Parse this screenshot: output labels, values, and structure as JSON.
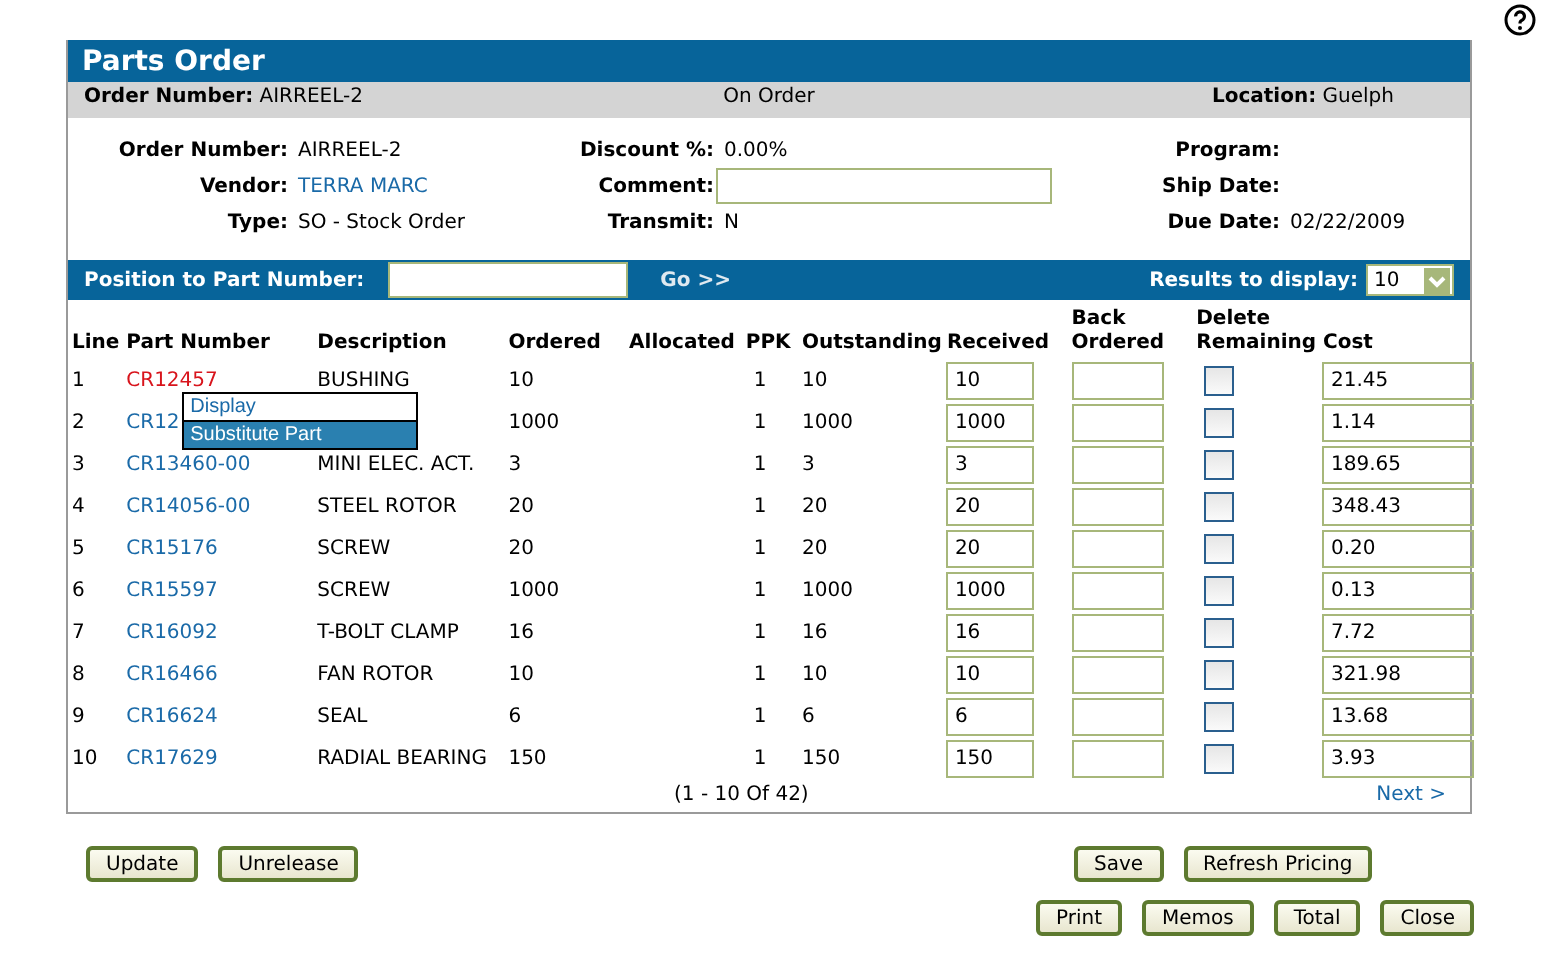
{
  "panel": {
    "title": "Parts Order"
  },
  "summary": {
    "order_label": "Order Number:",
    "order_value": "AIRREEL-2",
    "status": "On Order",
    "location_label": "Location:",
    "location_value": "Guelph"
  },
  "details": [
    {
      "label": "Order Number:",
      "value": "AIRREEL-2",
      "kind": "text"
    },
    {
      "label": "Discount %:",
      "value": "0.00%",
      "kind": "text"
    },
    {
      "label": "Program:",
      "kind": "text"
    },
    {
      "label": "Vendor:",
      "value": "TERRA MARC",
      "kind": "link"
    },
    {
      "label": "Comment:",
      "kind": "field"
    },
    {
      "label": "Ship Date:",
      "kind": "text"
    },
    {
      "label": "Type:",
      "value": "SO - Stock Order",
      "kind": "text"
    },
    {
      "label": "Transmit:",
      "value": "N",
      "kind": "text"
    },
    {
      "label": "Due Date:",
      "value": "02/22/2009",
      "kind": "text"
    }
  ],
  "search_bar": {
    "label": "Position to Part Number:",
    "go": "Go >>",
    "results_label": "Results to display:",
    "results_value": "10"
  },
  "table": {
    "columns": [
      "Line",
      "Part Number",
      "Description",
      "Ordered",
      "Allocated",
      "PPK",
      "Outstanding",
      "Received",
      "Back Ordered",
      "Delete Remaining",
      "Cost"
    ],
    "rows": [
      {
        "line": "1",
        "part": "CR12457",
        "description": "BUSHING",
        "ordered": "10",
        "ppk": "1",
        "outstanding": "10",
        "received": "10",
        "delete": false,
        "cost": "21.45",
        "selected": true
      },
      {
        "line": "2",
        "part": "CR12",
        "ordered": "1000",
        "ppk": "1",
        "outstanding": "1000",
        "received": "1000",
        "delete": false,
        "cost": "1.14",
        "selected": false
      },
      {
        "line": "3",
        "part": "CR13460-00",
        "description": "MINI ELEC. ACT.",
        "ordered": "3",
        "ppk": "1",
        "outstanding": "3",
        "received": "3",
        "delete": false,
        "cost": "189.65",
        "selected": false
      },
      {
        "line": "4",
        "part": "CR14056-00",
        "description": "STEEL ROTOR",
        "ordered": "20",
        "ppk": "1",
        "outstanding": "20",
        "received": "20",
        "delete": false,
        "cost": "348.43",
        "selected": false
      },
      {
        "line": "5",
        "part": "CR15176",
        "description": "SCREW",
        "ordered": "20",
        "ppk": "1",
        "outstanding": "20",
        "received": "20",
        "delete": false,
        "cost": "0.20",
        "selected": false
      },
      {
        "line": "6",
        "part": "CR15597",
        "description": "SCREW",
        "ordered": "1000",
        "ppk": "1",
        "outstanding": "1000",
        "received": "1000",
        "delete": false,
        "cost": "0.13",
        "selected": false
      },
      {
        "line": "7",
        "part": "CR16092",
        "description": "T-BOLT CLAMP",
        "ordered": "16",
        "ppk": "1",
        "outstanding": "16",
        "received": "16",
        "delete": false,
        "cost": "7.72",
        "selected": false
      },
      {
        "line": "8",
        "part": "CR16466",
        "description": "FAN ROTOR",
        "ordered": "10",
        "ppk": "1",
        "outstanding": "10",
        "received": "10",
        "delete": false,
        "cost": "321.98",
        "selected": false
      },
      {
        "line": "9",
        "part": "CR16624",
        "description": "SEAL",
        "ordered": "6",
        "ppk": "1",
        "outstanding": "6",
        "received": "6",
        "delete": false,
        "cost": "13.68",
        "selected": false
      },
      {
        "line": "10",
        "part": "CR17629",
        "description": "RADIAL BEARING",
        "ordered": "150",
        "ppk": "1",
        "outstanding": "150",
        "received": "150",
        "delete": false,
        "cost": "3.93",
        "selected": false
      }
    ],
    "pagination": "(1 - 10 Of 42)",
    "next": "Next >"
  },
  "context_menu": [
    {
      "label": "Display",
      "selected": false
    },
    {
      "label": "Substitute Part",
      "selected": true
    }
  ],
  "buttons_left": [
    "Update",
    "Unrelease"
  ],
  "buttons_right": [
    "Save",
    "Refresh Pricing"
  ],
  "buttons_bottom": [
    "Print",
    "Memos",
    "Total",
    "Close"
  ]
}
